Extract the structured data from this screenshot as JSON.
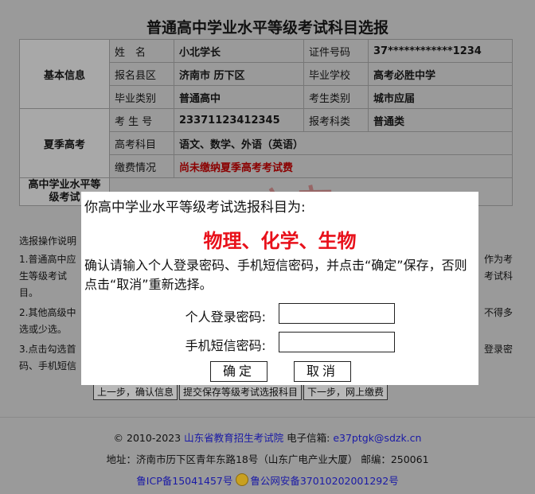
{
  "page_title": "普通高中学业水平等级考试科目选报",
  "basic": {
    "section": "基本信息",
    "name_label": "姓　名",
    "name_value": "小北学长",
    "id_label": "证件号码",
    "id_value": "37************1234",
    "county_label": "报名县区",
    "county_value": "济南市 历下区",
    "school_label": "毕业学校",
    "school_value": "高考必胜中学",
    "grad_type_label": "毕业类别",
    "grad_type_value": "普通高中",
    "exam_type_label": "考生类别",
    "exam_type_value": "城市应届"
  },
  "summer": {
    "section": "夏季高考",
    "exam_no_label": "考 生 号",
    "exam_no_value": "23371123412345",
    "category_label": "报考科类",
    "category_value": "普通类",
    "subjects_label": "高考科目",
    "subjects_value": "语文、数学、外语（英语）",
    "fee_label": "缴费情况",
    "fee_value": "尚未缴纳夏季高考考试费"
  },
  "level_section": "高中学业水平等级考试",
  "instructions": {
    "heading": "选报操作说明",
    "item1_left": "1.普通高中应",
    "item1_right": "作为考",
    "item1b_left": "生等级考试",
    "item1b_right": "考试科",
    "item1c": "目。",
    "item2_left": "2.其他高级中",
    "item2_right": "不得多",
    "item2b": "选或少选。",
    "item3_left": "3.点击勾选首",
    "item3_right": "登录密",
    "item3b": "码、手机短信"
  },
  "actions": {
    "prev": "上一步，确认信息",
    "submit": "提交保存等级考试选报科目",
    "next": "下一步，网上缴费"
  },
  "footer": {
    "copyright": "© 2010-2023",
    "org": "山东省教育招生考试院",
    "email_label": "电子信箱:",
    "email": "e37ptgk@sdzk.cn",
    "address": "地址：济南市历下区青年东路18号（山东广电产业大厦）   邮编：250061",
    "icp": "鲁ICP备15041457号",
    "police": "鲁公网安备37010202001292号"
  },
  "watermark": "小北学长",
  "dialog": {
    "title": "你高中学业水平等级考试选报科目为:",
    "subjects": "物理、化学、生物",
    "message": "确认请输入个人登录密码、手机短信密码，并点击“确定”保存，否则点击“取消”重新选择。",
    "password_label": "个人登录密码:",
    "sms_label": "手机短信密码:",
    "confirm": "确定",
    "cancel": "取消"
  }
}
